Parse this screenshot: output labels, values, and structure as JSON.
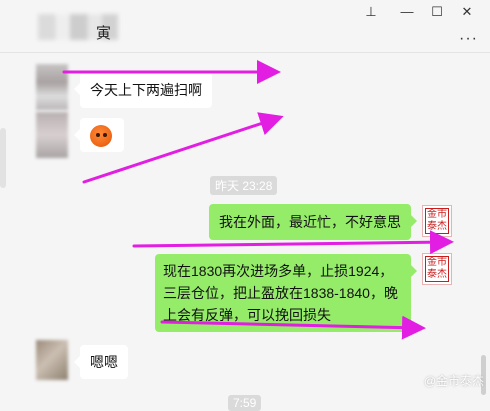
{
  "window": {
    "title_suffix": "寅",
    "controls": {
      "pin": "⊥",
      "minimize": "—",
      "maximize": "☐",
      "close": "✕"
    },
    "more": "···"
  },
  "messages": [
    {
      "side": "in",
      "text": "今天上下两遍扫啊"
    },
    {
      "side": "in",
      "sticker": "orange-face-sticker"
    },
    {
      "timestamp": "昨天 23:28"
    },
    {
      "side": "out",
      "text": "我在外面，最近忙，不好意思"
    },
    {
      "side": "out",
      "lines": [
        "现在1830再次进场多单，止损1924，",
        "三层仓位，把止盈放在1838-1840，晚",
        "上会有反弹，可以挽回损失"
      ]
    },
    {
      "side": "in",
      "text": "嗯嗯"
    },
    {
      "timestamp": "7:59"
    }
  ],
  "seal": {
    "line1": "金市",
    "line2": "泰杰"
  },
  "watermark": "@金市泰杰",
  "colors": {
    "outgoing_bubble": "#95ec69",
    "incoming_bubble": "#ffffff",
    "arrow": "#e11ee1",
    "background": "#f5f5f5"
  }
}
